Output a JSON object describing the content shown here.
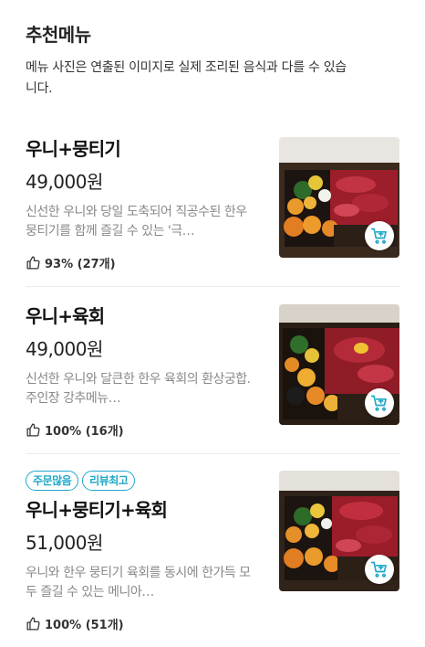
{
  "header": {
    "title": "추천메뉴",
    "notice": "메뉴 사진은 연출된 이미지로 실제 조리된 음식과 다를 수 있습니다."
  },
  "items": [
    {
      "name": "우니+뭉티기",
      "price": "49,000원",
      "description": "신선한 우니와 당일 도축되어 직공수된 한우 뭉티기를 함께 즐길 수 있는 '극…",
      "rating": "93% (27개)",
      "badges": []
    },
    {
      "name": "우니+육회",
      "price": "49,000원",
      "description": "신선한 우니와 달큰한 한우 육회의 환상궁합. 주인장 강추메뉴…",
      "rating": "100% (16개)",
      "badges": []
    },
    {
      "name": "우니+뭉티기+육회",
      "price": "51,000원",
      "description": "우니와 한우 뭉티기 육회를 동시에 한가득 모두 즐길 수 있는 메니아…",
      "rating": "100% (51개)",
      "badges": [
        "주문많음",
        "리뷰최고"
      ]
    }
  ],
  "icons": {
    "thumbs_up": "thumbs-up-icon",
    "cart": "cart-plus-icon"
  },
  "colors": {
    "accent": "#1fa8c8",
    "description_text": "#888888",
    "divider": "#ececec"
  }
}
